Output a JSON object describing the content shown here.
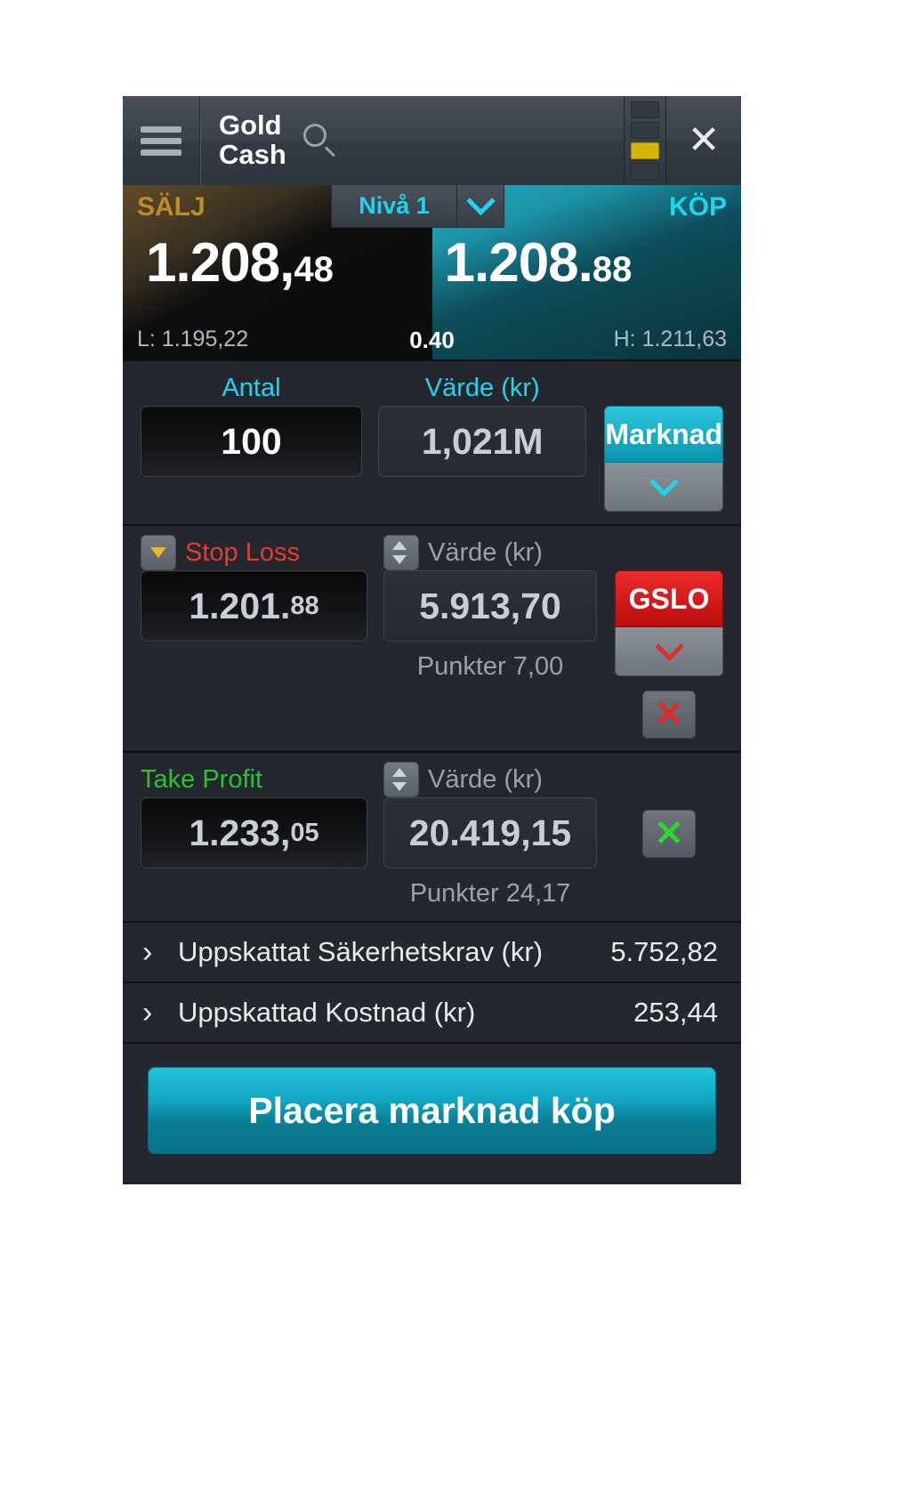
{
  "header": {
    "title_line1": "Gold",
    "title_line2": "Cash",
    "menu_icon": "hamburger-icon",
    "search_icon": "search-icon",
    "close_label": "✕"
  },
  "price": {
    "sell_label": "SÄLJ",
    "buy_label": "KÖP",
    "sell_price_main": "1.208,",
    "sell_price_dec": "48",
    "buy_price_main": "1.208.",
    "buy_price_dec": "88",
    "low_label": "L: 1.195,22",
    "high_label": "H: 1.211,63",
    "spread": "0.40",
    "level_label": "Nivå 1",
    "level_caret_icon": "chevron-down-icon"
  },
  "order": {
    "quantity_label": "Antal",
    "quantity_value": "100",
    "value_label": "Värde (kr)",
    "value_value": "1,021M",
    "order_type_label": "Marknad",
    "order_type_caret_icon": "chevron-down-icon"
  },
  "stop_loss": {
    "label": "Stop Loss",
    "icon": "arrow-down-icon",
    "value_main": "1.201.",
    "value_dec": "88",
    "value_label": "Värde (kr)",
    "value_label_icon": "up-down-arrows-icon",
    "value_amount": "5.913,70",
    "points": "Punkter 7,00",
    "gslo_label": "GSLO",
    "gslo_caret_icon": "chevron-down-icon",
    "remove_icon": "close-x-icon",
    "remove_label": "✕"
  },
  "take_profit": {
    "label": "Take Profit",
    "value_main": "1.233,",
    "value_dec": "05",
    "value_label": "Värde (kr)",
    "value_label_icon": "up-down-arrows-icon",
    "value_amount": "20.419,15",
    "points": "Punkter 24,17",
    "remove_icon": "close-x-icon",
    "remove_label": "✕"
  },
  "info_rows": [
    {
      "chevron": "›",
      "label": "Uppskattat Säkerhetskrav (kr)",
      "value": "5.752,82"
    },
    {
      "chevron": "›",
      "label": "Uppskattad Kostnad (kr)",
      "value": "253,44"
    }
  ],
  "cta": {
    "label": "Placera marknad köp"
  },
  "colors": {
    "accent_cyan": "#22d3ee",
    "sell_amber": "#c08a2b",
    "danger_red": "#e23b30",
    "success_green": "#2fbf33",
    "indicator_yellow": "#d4b508"
  }
}
